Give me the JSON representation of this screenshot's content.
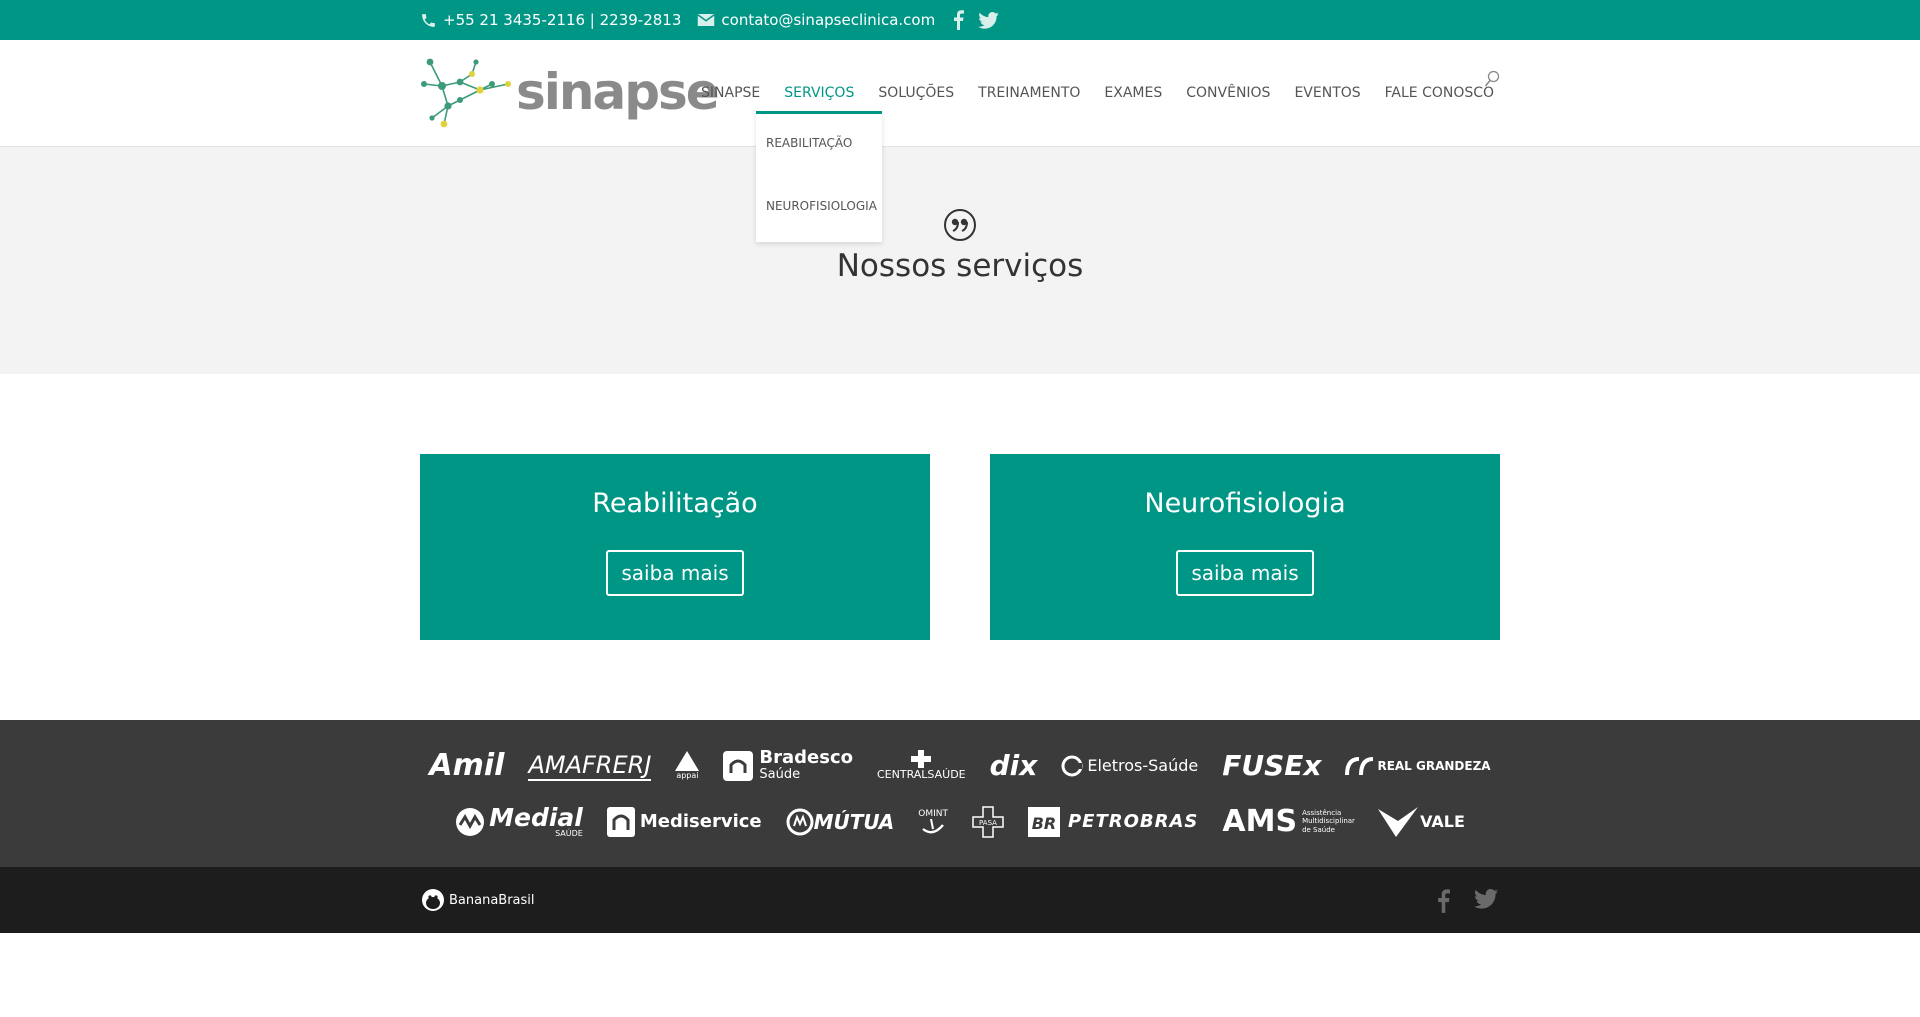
{
  "topbar": {
    "phone": "+55 21 3435-2116 | 2239-2813",
    "email": "contato@sinapseclinica.com",
    "social": [
      "facebook-icon",
      "twitter-icon"
    ]
  },
  "brand": {
    "name": "sinapse"
  },
  "nav": {
    "items": [
      "SINAPSE",
      "SERVIÇOS",
      "SOLUÇÕES",
      "TREINAMENTO",
      "EXAMES",
      "CONVÊNIOS",
      "EVENTOS",
      "FALE CONOSCO"
    ],
    "active": "SERVIÇOS",
    "dropdown": [
      "REABILITAÇÃO",
      "NEUROFISIOLOGIA"
    ]
  },
  "hero": {
    "title": "Nossos serviços"
  },
  "services": [
    {
      "title": "Reabilitação",
      "button": "saiba mais"
    },
    {
      "title": "Neurofisiologia",
      "button": "saiba mais"
    }
  ],
  "partners": {
    "row1": [
      "Amil",
      "AMAFRERJ",
      "appai",
      "Bradesco",
      "Saúde",
      "CENTRALSAÚDE",
      "dix",
      "Eletros-Saúde",
      "FUSEx",
      "REAL GRANDEZA"
    ],
    "row2": [
      "Medial",
      "SAÚDE",
      "Mediservice",
      "MÚTUA",
      "OMINT",
      "PASA",
      "PETROBRAS",
      "AMS",
      "Assistência Multidisciplinar de Saúde",
      "VALE"
    ]
  },
  "footer": {
    "credit": "BananaBrasil"
  },
  "colors": {
    "accent": "#009685",
    "logos_bg": "#3b3b3b",
    "footer_bg": "#1d1d1d",
    "hero_bg": "#f3f3f3"
  }
}
